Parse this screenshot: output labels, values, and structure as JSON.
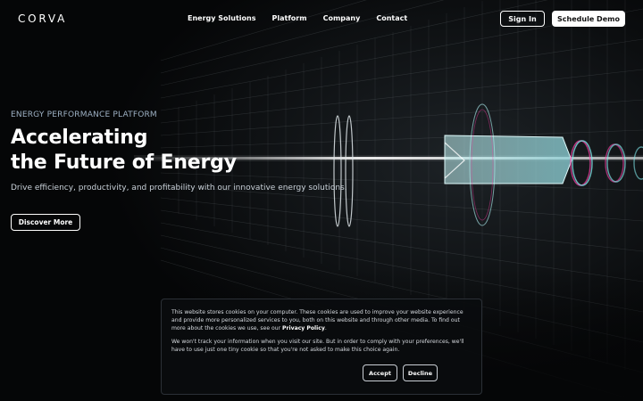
{
  "brand": {
    "logo": "CORVA"
  },
  "nav": {
    "links": [
      "Energy Solutions",
      "Platform",
      "Company",
      "Contact"
    ],
    "sign_in": "Sign In",
    "schedule_demo": "Schedule Demo"
  },
  "hero": {
    "eyebrow": "ENERGY PERFORMANCE PLATFORM",
    "headline_line1": "Accelerating",
    "headline_line2": "the Future of Energy",
    "subtext": "Drive efficiency, productivity, and profitability with our innovative energy solutions.",
    "cta": "Discover More"
  },
  "cookie": {
    "text1_before": "This website stores cookies on your computer. These cookies are used to improve your website experience and provide more personalized services to you, both on this website and through other media. To find out more about the cookies we use, see our ",
    "privacy_link": "Privacy Policy",
    "text1_after": ".",
    "text2": "We won't track your information when you visit our site. But in order to comply with your preferences, we'll have to use just one tiny cookie so that you're not asked to make this choice again.",
    "accept": "Accept",
    "decline": "Decline"
  },
  "colors": {
    "background": "#050607",
    "grid": "#8a9096",
    "accent_cyan": "#7fe3e6",
    "accent_magenta": "#ff3fa8"
  }
}
